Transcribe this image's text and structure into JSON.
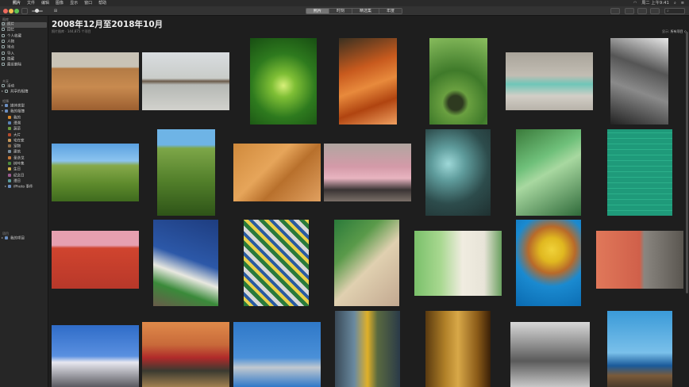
{
  "menubar": {
    "apple": "",
    "items": [
      "照片",
      "文件",
      "编辑",
      "图像",
      "显示",
      "窗口",
      "帮助"
    ],
    "clock": "周二 上午9:41"
  },
  "toolbar": {
    "segments": [
      "照片",
      "时刻",
      "精选集",
      "年度"
    ],
    "active_segment": "照片"
  },
  "sidebar": {
    "sections": [
      {
        "title": "图库",
        "items": [
          {
            "label": "照片",
            "icon": "photos-icon",
            "selected": true
          },
          {
            "label": "回忆",
            "icon": "memories-icon"
          },
          {
            "label": "个人收藏",
            "icon": "favorites-icon"
          },
          {
            "label": "人物",
            "icon": "people-icon"
          },
          {
            "label": "地点",
            "icon": "places-icon"
          },
          {
            "label": "导入",
            "icon": "import-icon"
          },
          {
            "label": "隐藏",
            "icon": "hidden-icon"
          },
          {
            "label": "最近删除",
            "icon": "trash-icon"
          }
        ]
      },
      {
        "title": "共享",
        "items": [
          {
            "label": "活动",
            "icon": "activity-icon"
          },
          {
            "label": "共享的相簿",
            "icon": "shared-albums-icon",
            "arrow": "right"
          }
        ]
      },
      {
        "title": "相簿",
        "items": [
          {
            "label": "媒体类型",
            "icon": "folder-icon",
            "arrow": "right"
          },
          {
            "label": "我的相簿",
            "icon": "folder-icon",
            "arrow": "down"
          },
          {
            "label": "我的",
            "icon": "album-icon",
            "thumb": "#d8872a",
            "indent": 2
          },
          {
            "label": "漫溯",
            "icon": "album-icon",
            "thumb": "#5b83b7",
            "indent": 2
          },
          {
            "label": "蔬菜",
            "icon": "album-icon",
            "thumb": "#6f9b3e",
            "indent": 2
          },
          {
            "label": "大片",
            "icon": "album-icon",
            "thumb": "#b2492d",
            "indent": 2
          },
          {
            "label": "宅在家",
            "icon": "album-icon",
            "thumb": "#c89a5b",
            "indent": 2
          },
          {
            "label": "宠物",
            "icon": "album-icon",
            "thumb": "#8a6a4a",
            "indent": 2
          },
          {
            "label": "建筑",
            "icon": "album-icon",
            "thumb": "#7a8e9e",
            "indent": 2
          },
          {
            "label": "圣迭戈",
            "icon": "album-icon",
            "thumb": "#c77a3a",
            "indent": 2
          },
          {
            "label": "树叶集",
            "icon": "album-icon",
            "thumb": "#4c8a3e",
            "indent": 2
          },
          {
            "label": "生日",
            "icon": "album-icon",
            "thumb": "#d6b14a",
            "indent": 2
          },
          {
            "label": "纪念日",
            "icon": "album-icon",
            "thumb": "#9b5b8e",
            "indent": 2
          },
          {
            "label": "漫日",
            "icon": "album-icon",
            "thumb": "#5a9a9a",
            "indent": 2
          },
          {
            "label": "iPhoto 事件",
            "icon": "folder-icon",
            "arrow": "right",
            "indent": 1
          }
        ]
      },
      {
        "title": "项目",
        "items": [
          {
            "label": "我的项目",
            "icon": "folder-icon",
            "arrow": "right"
          }
        ]
      }
    ]
  },
  "main": {
    "title": "2008年12月至2018年10月",
    "subtitle": "照片图库 · 144,875 个项目",
    "view_label": "显示:",
    "view_value": "所有项目 ◇"
  },
  "photos": [
    {
      "name": "desert-dunes",
      "bg": "linear-gradient(180deg,#c9c3b6 0%,#c9c3b6 25%,#b37b45 28%,#c88a4f 60%,#9c5f30 100%)"
    },
    {
      "name": "camel-beach",
      "bg": "linear-gradient(180deg,#d9dde0 0%,#c9ccc9 45%,#6a5a4a 50%,#b5b8b4 56%,#d2d2cd 100%)"
    },
    {
      "name": "palm-leaf",
      "bg": "radial-gradient(circle at 50% 55%,#d8f07a 0%,#7fbf35 20%,#2e7a1e 55%,#174d12 100%)"
    },
    {
      "name": "orange-stairs",
      "bg": "linear-gradient(160deg,#3a3020 0%,#c85a1e 35%,#e88a3c 55%,#b04410 75%,#f0a060 100%)"
    },
    {
      "name": "hanging-fruit",
      "bg": "radial-gradient(circle at 45% 75%,#2e3a20 0%,#2e3a20 10%,#6aa040 18%,#3f7a2a 45%,#8cc060 100%)"
    },
    {
      "name": "pool-chairs",
      "bg": "linear-gradient(180deg,#a9a49a 0%,#c2bdb3 40%,#6fc6b8 55%,#d2cec6 75%,#b8b3aa 100%)"
    },
    {
      "name": "bw-hillside",
      "bg": "linear-gradient(200deg,#e8e8e8 0%,#555 35%,#8a8a8a 60%,#222 100%)"
    },
    {
      "name": "green-field",
      "bg": "linear-gradient(180deg,#5aa0e0 0%,#8cc4ef 30%,#86a94a 38%,#5d8a2c 70%,#3f6a1e 100%)"
    },
    {
      "name": "grass-hill",
      "bg": "linear-gradient(180deg,#6eb4e6 0%,#6eb4e6 18%,#7da648 22%,#527f2a 60%,#2e5418 100%)"
    },
    {
      "name": "wood-panel",
      "bg": "linear-gradient(135deg,#d08a3c 0%,#e6a55a 40%,#b8702c 60%,#e0a060 100%)"
    },
    {
      "name": "pink-car",
      "bg": "linear-gradient(180deg,#b0a6a0 0%,#d49aa8 40%,#e8b4c0 60%,#3a3434 80%,#7a6f68 100%)"
    },
    {
      "name": "teal-lamp",
      "bg": "radial-gradient(circle at 35% 40%,#9ed8d8 0%,#5f9c9c 25%,#2d4c4c 60%,#1f3030 100%)"
    },
    {
      "name": "aerial-green",
      "bg": "linear-gradient(150deg,#3a7a3a 0%,#6fc07a 35%,#a8d8a0 50%,#2f6a3a 100%)"
    },
    {
      "name": "pool-ball",
      "bg": "repeating-linear-gradient(0deg,#1f9a7a 0px,#1f9a7a 6px,#2bb08a 6px,#2bb08a 7px),#1f9a7a"
    },
    {
      "name": "red-wall-shadow",
      "bg": "linear-gradient(180deg,#e6a0b0 0%,#e6a0b0 25%,#d0442e 30%,#b8382a 100%)"
    },
    {
      "name": "blue-sky-building",
      "bg": "linear-gradient(200deg,#1e3d80 0%,#2c58a8 45%,#e8e8e0 62%,#3a8a3a 78%,#6a5a4a 100%)"
    },
    {
      "name": "zigzag-fence",
      "bg": "repeating-linear-gradient(45deg,#2a7a3a 0px,#2a7a3a 5px,#e8d04a 5px,#e8d04a 9px,#2a5aa0 9px,#2a5aa0 13px,#d8d8d8 13px,#d8d8d8 18px)"
    },
    {
      "name": "green-triangle",
      "bg": "linear-gradient(135deg,#2a7a3a 0%,#5a9a4a 30%,#e0d0b0 55%,#c2a890 100%)"
    },
    {
      "name": "chaplin-door",
      "bg": "linear-gradient(90deg,#7ac06a 0%,#a8d890 30%,#f0ece0 55%,#e8e4d8 80%,#6aa060 100%)"
    },
    {
      "name": "yellow-hat",
      "bg": "radial-gradient(circle at 55% 35%,#f0d23a 0%,#e0b820 18%,#b86a2a 35%,#1a8ad0 55%,#0a6ab0 100%)"
    },
    {
      "name": "stairway",
      "bg": "linear-gradient(90deg,#e0785a 0%,#d0604a 50%,#8a8680 55%,#5a5650 100%)"
    },
    {
      "name": "laundry-line",
      "bg": "linear-gradient(180deg,#2f6cc8 0%,#5a90e0 50%,#e8e8f0 60%,#5a5a60 100%)"
    },
    {
      "name": "bistro-street",
      "bg": "linear-gradient(180deg,#e08a4a 0%,#c86a3a 35%,#b02a2a 55%,#3a3a30 75%,#a08050 100%)"
    },
    {
      "name": "horse-statue",
      "bg": "linear-gradient(180deg,#2f78c8 0%,#4a90d8 55%,#c0c8d0 70%,#2f78c8 100%)"
    },
    {
      "name": "yellow-flowers",
      "bg": "linear-gradient(90deg,#3a4a58 0%,#6a8aa0 30%,#e0b028 50%,#5a6a40 65%,#2a3a48 100%)"
    },
    {
      "name": "curtain-lamp",
      "bg": "linear-gradient(90deg,#5a3a10 0%,#b08028 30%,#d8a848 50%,#8a5a18 80%,#3a2008 100%)"
    },
    {
      "name": "bw-sand",
      "bg": "linear-gradient(180deg,#d8d8d8 0%,#9a9a9a 30%,#5a5a5a 60%,#c8c8c8 100%)"
    },
    {
      "name": "coast-sky",
      "bg": "linear-gradient(180deg,#3a9ad8 0%,#7ac0ea 55%,#1a5a9a 72%,#7a5a3a 85%,#4a3a2a 100%)"
    }
  ]
}
